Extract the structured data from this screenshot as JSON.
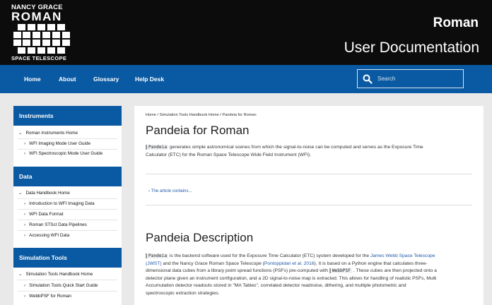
{
  "header": {
    "logo_line1": "NANCY GRACE",
    "logo_line2": "ROMAN",
    "logo_line3": "SPACE TELESCOPE",
    "title": "Roman",
    "subtitle": "User Documentation"
  },
  "nav": {
    "items": [
      "Home",
      "About",
      "Glossary",
      "Help Desk"
    ],
    "search_placeholder": "Search"
  },
  "sidebar": {
    "sections": [
      {
        "heading": "Instruments",
        "root": "Roman Instruments Home",
        "children": [
          "WFI Imaging Mode User Guide",
          "WFI Spectroscopic Mode User Guide"
        ]
      },
      {
        "heading": "Data",
        "root": "Data Handbook Home",
        "children": [
          "Introduction to WFI Imaging Data",
          "WFI Data Format",
          "Roman STScI Data Pipelines",
          "Accessing WFI Data"
        ]
      },
      {
        "heading": "Simulation Tools",
        "root": "Simulation Tools Handbook Home",
        "children": [
          "Simulation Tools Quick Start Guide",
          "WebbPSF for Roman"
        ]
      }
    ]
  },
  "main": {
    "breadcrumb": "Home / Simulation Tools Handbook Home / Pandeia for Roman",
    "title": "Pandeia for Roman",
    "intro_code": "Pandeia",
    "intro_line1": " generates simple astronomical scenes from which the signal-to-noise can be computed and serves as the Exposure Time",
    "intro_line2": "Calculator (ETC) for the Roman Space Telescope Wide Field Instrument (WFI).",
    "contains": "The article contains...",
    "section_title": "Pandeia Description",
    "desc": {
      "code1": "Pandeia",
      "t1": " is the backend software used for the Exposure Time Calculator (ETC) system developed for the ",
      "link1": "James Webb Space Telescope",
      "link1b": "(JWST)",
      "t2": " and the Nancy Grace Roman Space Telescope (",
      "link2": "Pontoppidan et al. 2016",
      "t3": "). It is based on a Python engine that calculates three-",
      "t4": "dimensional data cubes from a library point spread functions (PSFs) pre-computed with ",
      "code2": "WebbPSF",
      "t5": " . These cubes are then projected onto a",
      "line4": "detector plane given an instrument configuration, and a 2D signal-to-noise map is extracted. This allows for handling of realistic PSFs, Multi",
      "line5": "Accumulation detector readouts stored in \"MA Tables\", correlated detector readnoise, dithering, and multiple photometric and",
      "line6": "spectroscopic extraction strategies."
    }
  },
  "colors": {
    "nav_blue": "#0a5aa3",
    "header_black": "#0c0c0c",
    "link": "#2058a8"
  }
}
